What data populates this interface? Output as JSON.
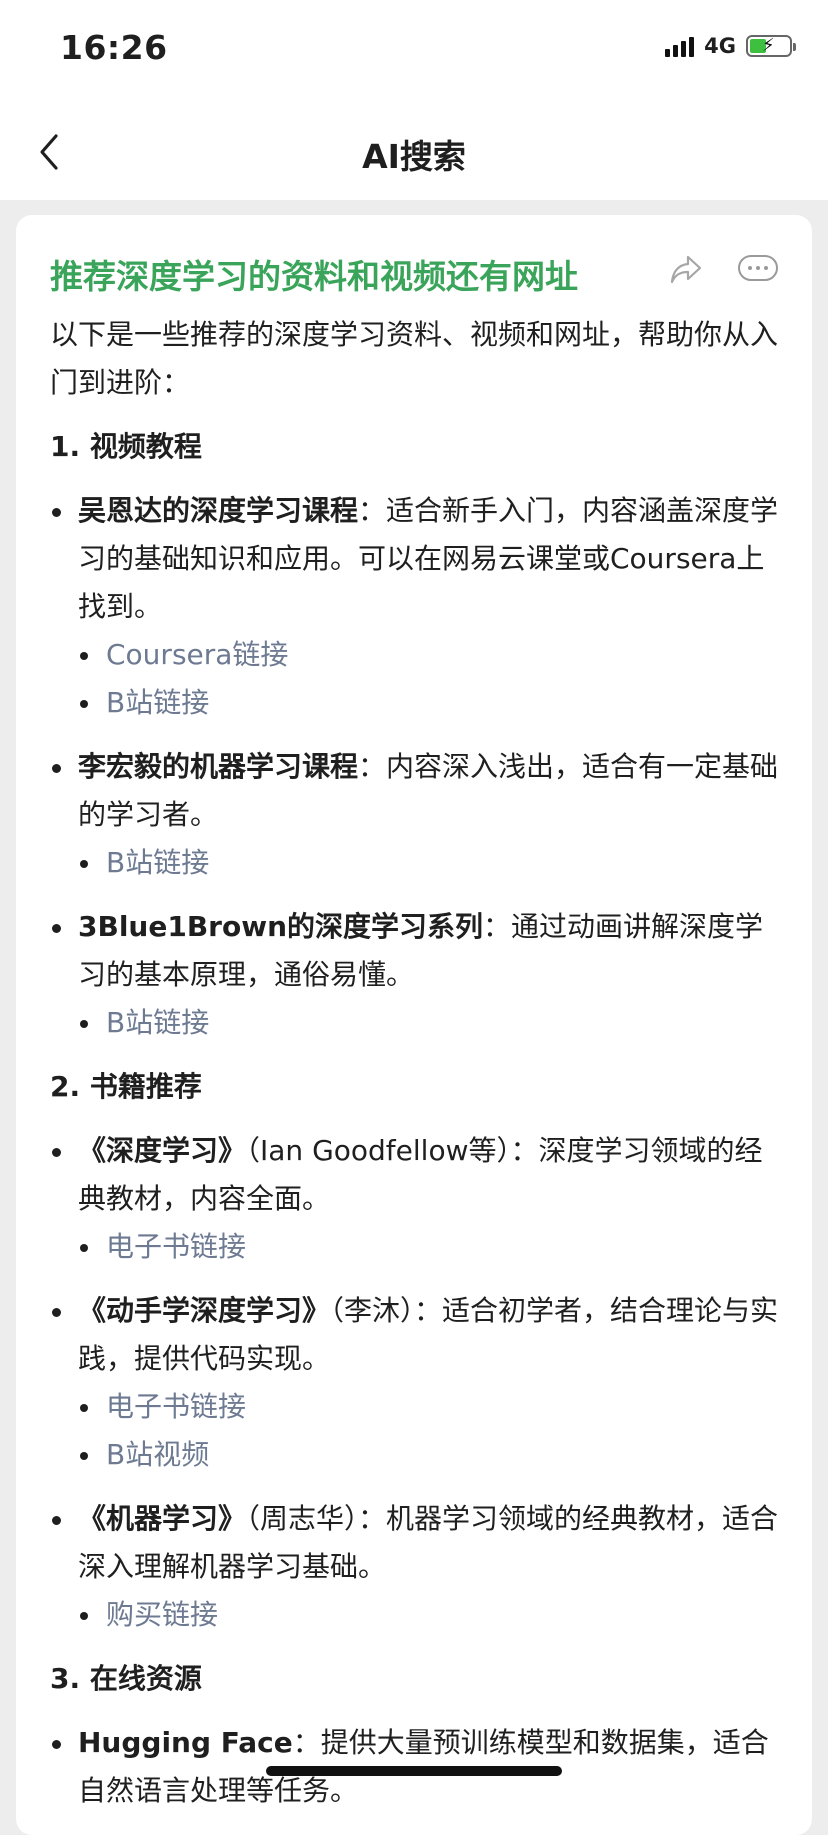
{
  "status_bar": {
    "time": "16:26",
    "network": "4G"
  },
  "nav": {
    "title": "AI搜索"
  },
  "question": {
    "title": "推荐深度学习的资料和视频还有网址"
  },
  "intro": "以下是一些推荐的深度学习资料、视频和网址，帮助你从入门到进阶：",
  "sections": [
    {
      "heading": "1. 视频教程",
      "items": [
        {
          "name": "吴恩达的深度学习课程",
          "desc": "：适合新手入门，内容涵盖深度学习的基础知识和应用。可以在网易云课堂或Coursera上找到。",
          "links": [
            "Coursera链接",
            "B站链接"
          ]
        },
        {
          "name": "李宏毅的机器学习课程",
          "desc": "：内容深入浅出，适合有一定基础的学习者。",
          "links": [
            "B站链接"
          ]
        },
        {
          "name": "3Blue1Brown的深度学习系列",
          "desc": "：通过动画讲解深度学习的基本原理，通俗易懂。",
          "links": [
            "B站链接"
          ]
        }
      ]
    },
    {
      "heading": "2. 书籍推荐",
      "items": [
        {
          "name": "《深度学习》",
          "desc": "（Ian Goodfellow等）：深度学习领域的经典教材，内容全面。",
          "links": [
            "电子书链接"
          ]
        },
        {
          "name": "《动手学深度学习》",
          "desc": "（李沐）：适合初学者，结合理论与实践，提供代码实现。",
          "links": [
            "电子书链接",
            "B站视频"
          ]
        },
        {
          "name": "《机器学习》",
          "desc": "（周志华）：机器学习领域的经典教材，适合深入理解机器学习基础。",
          "links": [
            "购买链接"
          ]
        }
      ]
    },
    {
      "heading": "3. 在线资源",
      "items": [
        {
          "name": "Hugging Face",
          "desc": "：提供大量预训练模型和数据集，适合自然语言处理等任务。",
          "links": []
        }
      ]
    }
  ],
  "colors": {
    "title_green": "#3aa55a",
    "link": "#6d7a92",
    "background": "#ededed"
  },
  "icons": [
    "back-chevron-icon",
    "share-icon",
    "more-icon",
    "signal-icon",
    "battery-icon"
  ]
}
